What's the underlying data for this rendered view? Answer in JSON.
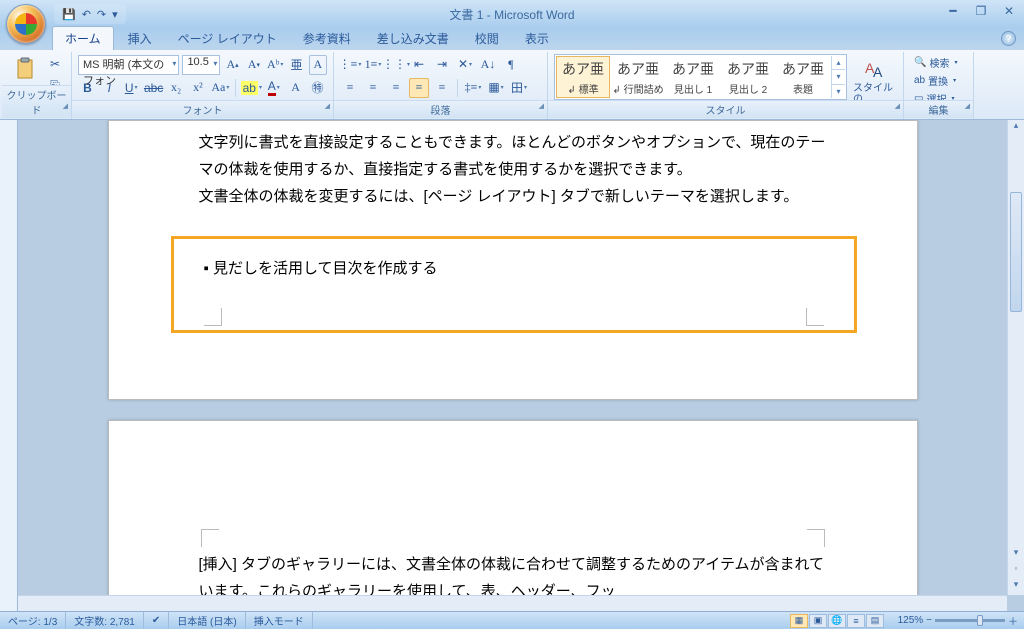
{
  "title": "文書 1 - Microsoft Word",
  "qat": {
    "save": "💾",
    "undo": "↶",
    "redo": "↷"
  },
  "tabs": [
    "ホーム",
    "挿入",
    "ページ レイアウト",
    "参考資料",
    "差し込み文書",
    "校閲",
    "表示"
  ],
  "active_tab": 0,
  "ribbon": {
    "clipboard": {
      "label": "クリップボード",
      "paste": "貼り付け"
    },
    "font": {
      "label": "フォント",
      "name": "MS 明朝 (本文のフォン",
      "size": "10.5"
    },
    "paragraph": {
      "label": "段落"
    },
    "styles": {
      "label": "スタイル",
      "items": [
        {
          "sample": "あア亜",
          "name": "↲ 標準",
          "selected": true
        },
        {
          "sample": "あア亜",
          "name": "↲ 行間詰め"
        },
        {
          "sample": "あア亜",
          "name": "見出し 1"
        },
        {
          "sample": "あア亜",
          "name": "見出し 2"
        },
        {
          "sample": "あア亜",
          "name": "表題"
        }
      ],
      "change": "スタイルの\n変更"
    },
    "editing": {
      "label": "編集",
      "find": "検索",
      "replace": "置換",
      "select": "選択"
    }
  },
  "doc": {
    "p1": "文字列に書式を直接設定することもできます。ほとんどのボタンやオプションで、現在のテーマの体裁を使用するか、直接指定する書式を使用するかを選択できます。",
    "p2": "文書全体の体裁を変更するには、[ページ レイアウト] タブで新しいテーマを選択します。",
    "hl": "▪ 見だしを活用して目次を作成する",
    "p3": "[挿入] タブのギャラリーには、文書全体の体裁に合わせて調整するためのアイテムが含まれています。これらのギャラリーを使用して、表、ヘッダー、フッ"
  },
  "status": {
    "page": "ページ: 1/3",
    "words": "文字数: 2,781",
    "lang": "日本語 (日本)",
    "mode": "挿入モード",
    "zoom": "125%"
  }
}
